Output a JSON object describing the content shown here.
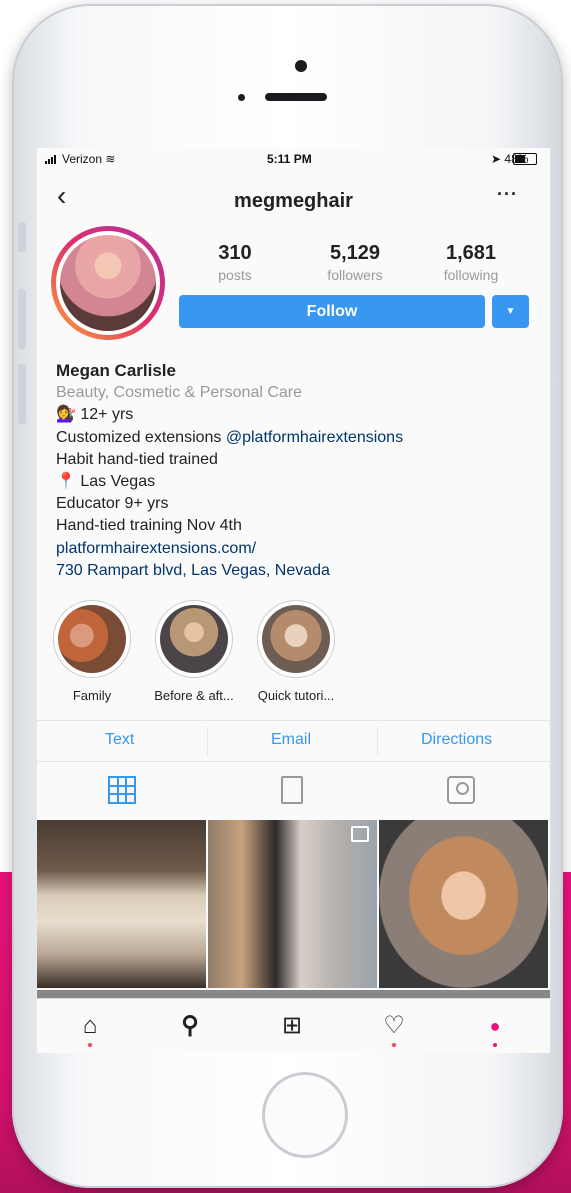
{
  "status_bar": {
    "carrier": "Verizon",
    "time": "5:11 PM",
    "battery": "48%",
    "battery_level": 0.48
  },
  "header": {
    "username": "megmeghair"
  },
  "stats": [
    {
      "value": "310",
      "label": "posts"
    },
    {
      "value": "5,129",
      "label": "followers"
    },
    {
      "value": "1,681",
      "label": "following"
    }
  ],
  "follow_label": "Follow",
  "bio": {
    "name": "Megan Carlisle",
    "category": "Beauty, Cosmetic & Personal Care",
    "line1_emoji": "💇‍♀️",
    "line1": "12+ yrs",
    "line2_prefix": "Customized extensions ",
    "line2_mention": "@platformhairextensions",
    "line3": "Habit hand-tied trained",
    "line4_emoji": "📍",
    "line4": "Las Vegas",
    "line5": "Educator 9+ yrs",
    "line6": "Hand-tied training Nov 4th",
    "website": "platformhairextensions.com/",
    "address": "730 Rampart blvd, Las Vegas, Nevada"
  },
  "highlights": [
    {
      "label": "Family"
    },
    {
      "label": "Before & aft..."
    },
    {
      "label": "Quick tutori..."
    }
  ],
  "contact": {
    "text": "Text",
    "email": "Email",
    "directions": "Directions"
  },
  "colors": {
    "accent": "#3897f0",
    "link": "#003569",
    "background_magenta": "#e8137a"
  },
  "icons": {
    "back": "back-arrow-icon",
    "more": "more-icon",
    "grid": "grid-icon",
    "list": "list-icon",
    "tagged": "tagged-icon",
    "home": "home-icon",
    "search": "search-icon",
    "add": "add-post-icon",
    "activity": "heart-icon",
    "profile": "profile-icon"
  }
}
